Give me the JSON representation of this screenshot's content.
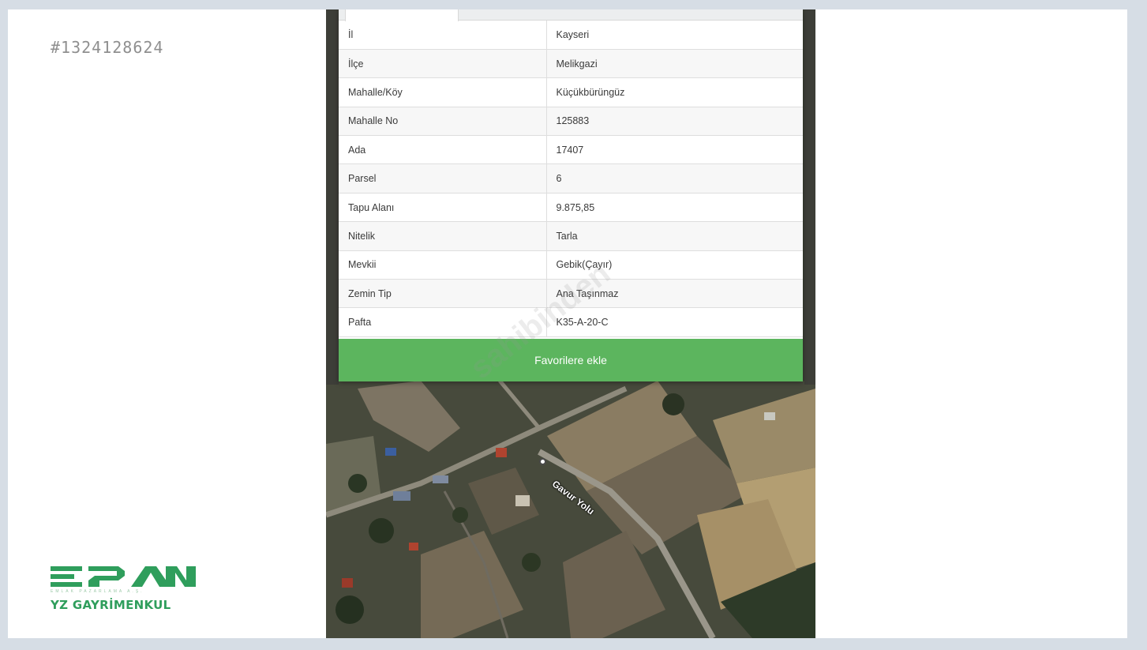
{
  "listing_id": "#1324128624",
  "parcel_table": {
    "rows": [
      {
        "label": "İl",
        "value": "Kayseri"
      },
      {
        "label": "İlçe",
        "value": "Melikgazi"
      },
      {
        "label": "Mahalle/Köy",
        "value": "Küçükbürüngüz"
      },
      {
        "label": "Mahalle No",
        "value": "125883"
      },
      {
        "label": "Ada",
        "value": "17407"
      },
      {
        "label": "Parsel",
        "value": "6"
      },
      {
        "label": "Tapu Alanı",
        "value": "9.875,85"
      },
      {
        "label": "Nitelik",
        "value": "Tarla"
      },
      {
        "label": "Mevkii",
        "value": "Gebik(Çayır)"
      },
      {
        "label": "Zemin Tip",
        "value": "Ana Taşınmaz"
      },
      {
        "label": "Pafta",
        "value": "K35-A-20-C"
      }
    ]
  },
  "favorite_button": {
    "label": "Favorilere ekle"
  },
  "watermark": {
    "text": "sahibinden"
  },
  "map": {
    "road_label": "Gavur Yolu"
  },
  "logo": {
    "mark": "EPA",
    "subtitle": "EMLAK PAZARLAMA A.Ş.",
    "name": "YZ GAYRİMENKUL"
  },
  "colors": {
    "accent_green": "#5cb55e",
    "logo_green": "#2f9e5c"
  }
}
